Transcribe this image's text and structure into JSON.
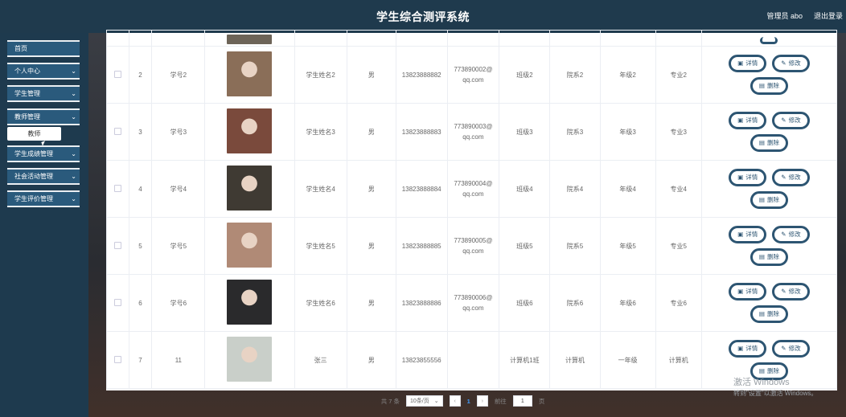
{
  "header": {
    "title": "学生综合测评系统",
    "user_label": "管理员 abo",
    "logout_label": "退出登录"
  },
  "sidebar": {
    "items": [
      {
        "label": "首页",
        "has_chevron": false
      },
      {
        "label": "个人中心",
        "has_chevron": true
      },
      {
        "label": "学生管理",
        "has_chevron": true
      },
      {
        "label": "教师管理",
        "has_chevron": true
      },
      {
        "label": "学生成绩管理",
        "has_chevron": true
      },
      {
        "label": "社会活动管理",
        "has_chevron": true
      },
      {
        "label": "学生评价管理",
        "has_chevron": true
      }
    ],
    "submenu_label": "教师"
  },
  "table": {
    "ops": {
      "detail": "详情",
      "edit": "修改",
      "delete": "删除"
    },
    "rows": [
      {
        "idx": "2",
        "no": "学号2",
        "name": "学生姓名2",
        "sex": "男",
        "phone": "13823888882",
        "email": "773890002@qq.com",
        "class": "班级2",
        "dept": "院系2",
        "grade": "年级2",
        "major": "专业2",
        "photo_color": "#8a6e58"
      },
      {
        "idx": "3",
        "no": "学号3",
        "name": "学生姓名3",
        "sex": "男",
        "phone": "13823888883",
        "email": "773890003@qq.com",
        "class": "班级3",
        "dept": "院系3",
        "grade": "年级3",
        "major": "专业3",
        "photo_color": "#7a4a3c"
      },
      {
        "idx": "4",
        "no": "学号4",
        "name": "学生姓名4",
        "sex": "男",
        "phone": "13823888884",
        "email": "773890004@qq.com",
        "class": "班级4",
        "dept": "院系4",
        "grade": "年级4",
        "major": "专业4",
        "photo_color": "#3f3a33"
      },
      {
        "idx": "5",
        "no": "学号5",
        "name": "学生姓名5",
        "sex": "男",
        "phone": "13823888885",
        "email": "773890005@qq.com",
        "class": "班级5",
        "dept": "院系5",
        "grade": "年级5",
        "major": "专业5",
        "photo_color": "#b08a76"
      },
      {
        "idx": "6",
        "no": "学号6",
        "name": "学生姓名6",
        "sex": "男",
        "phone": "13823888886",
        "email": "773890006@qq.com",
        "class": "班级6",
        "dept": "院系6",
        "grade": "年级6",
        "major": "专业6",
        "photo_color": "#2a2a2c"
      },
      {
        "idx": "7",
        "no": "11",
        "name": "张三",
        "sex": "男",
        "phone": "13823855556",
        "email": "",
        "class": "计算机1班",
        "dept": "计算机",
        "grade": "一年级",
        "major": "计算机",
        "photo_color": "#c9cfc9"
      }
    ]
  },
  "pagination": {
    "total": "共 7 条",
    "page_size": "10条/页",
    "current_page": "1",
    "goto_label": "前往",
    "goto_value": "1",
    "page_unit": "页"
  },
  "watermark": {
    "line1": "激活 Windows",
    "line2": "转到\"设置\"以激活 Windows。"
  }
}
